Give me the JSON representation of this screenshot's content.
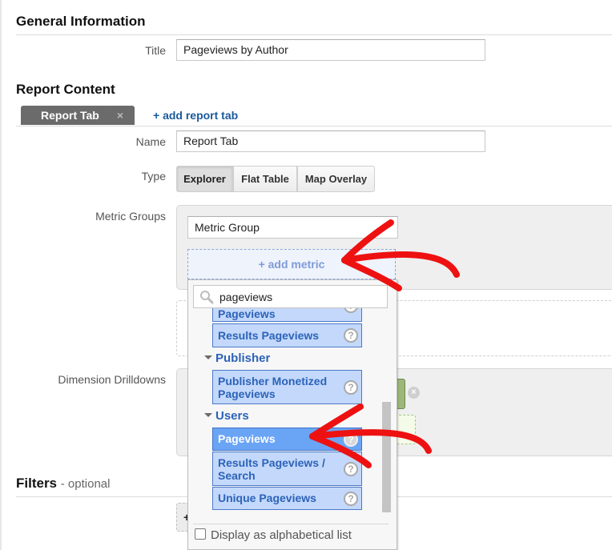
{
  "general": {
    "heading": "General Information",
    "title_label": "Title",
    "title_value": "Pageviews by Author"
  },
  "report_content": {
    "heading": "Report Content",
    "tabs": [
      {
        "label": "Report Tab",
        "close_icon": "×"
      }
    ],
    "add_tab_label": "+ add report tab",
    "name_label": "Name",
    "name_value": "Report Tab",
    "type_label": "Type",
    "type_options": [
      {
        "label": "Explorer",
        "selected": true
      },
      {
        "label": "Flat Table",
        "selected": false
      },
      {
        "label": "Map Overlay",
        "selected": false
      }
    ],
    "metric_groups_label": "Metric Groups",
    "metric_group_name": "Metric Group",
    "add_metric_label": "+ add metric",
    "dimension_drilldowns_label": "Dimension Drilldowns"
  },
  "metric_picker": {
    "search_value": "pageviews",
    "items_top": [
      {
        "label": "Pageviews",
        "partial": true
      },
      {
        "label": "Results Pageviews"
      }
    ],
    "groups": [
      {
        "name": "Publisher",
        "items": [
          {
            "label": "Publisher Monetized Pageviews"
          }
        ]
      },
      {
        "name": "Users",
        "items": [
          {
            "label": "Pageviews",
            "selected": true
          },
          {
            "label": "Results Pageviews / Search"
          },
          {
            "label": "Unique Pageviews"
          }
        ]
      }
    ],
    "help_icon": "?",
    "alphabetical_label": "Display as alphabetical list",
    "alphabetical_checked": false
  },
  "filters": {
    "heading": "Filters",
    "optional": "- optional",
    "add_label": "+"
  },
  "colors": {
    "accent_link": "#1a5a9c",
    "item_bg": "#c3d8fb",
    "item_selected_bg": "#6aa4f5",
    "annotation": "#ee1111"
  }
}
